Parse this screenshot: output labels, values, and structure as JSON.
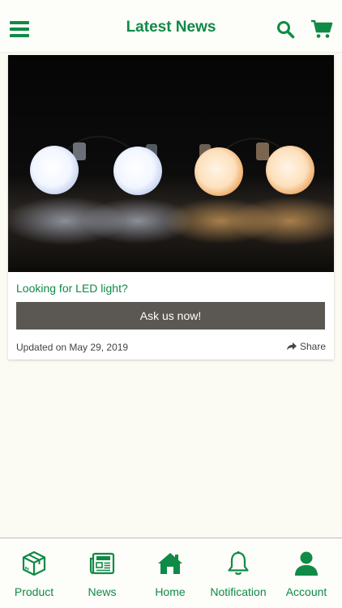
{
  "header": {
    "title": "Latest News",
    "menu_icon": "hamburger-menu-icon",
    "search_icon": "search-icon",
    "cart_icon": "shopping-cart-icon"
  },
  "news_card": {
    "image": "four-led-bulbs-photo",
    "headline": "Looking for LED light?",
    "cta_label": "Ask us now!",
    "updated": "Updated on May 29, 2019",
    "share_label": "Share",
    "share_icon": "share-arrow-icon"
  },
  "bottom_nav": {
    "items": [
      {
        "label": "Product",
        "icon": "package-icon"
      },
      {
        "label": "News",
        "icon": "newspaper-icon"
      },
      {
        "label": "Home",
        "icon": "home-icon"
      },
      {
        "label": "Notification",
        "icon": "bell-icon"
      },
      {
        "label": "Account",
        "icon": "user-icon"
      }
    ]
  },
  "colors": {
    "brand_green": "#0f8a47",
    "button_gray": "#5b5752",
    "background": "#fbfbf4"
  }
}
